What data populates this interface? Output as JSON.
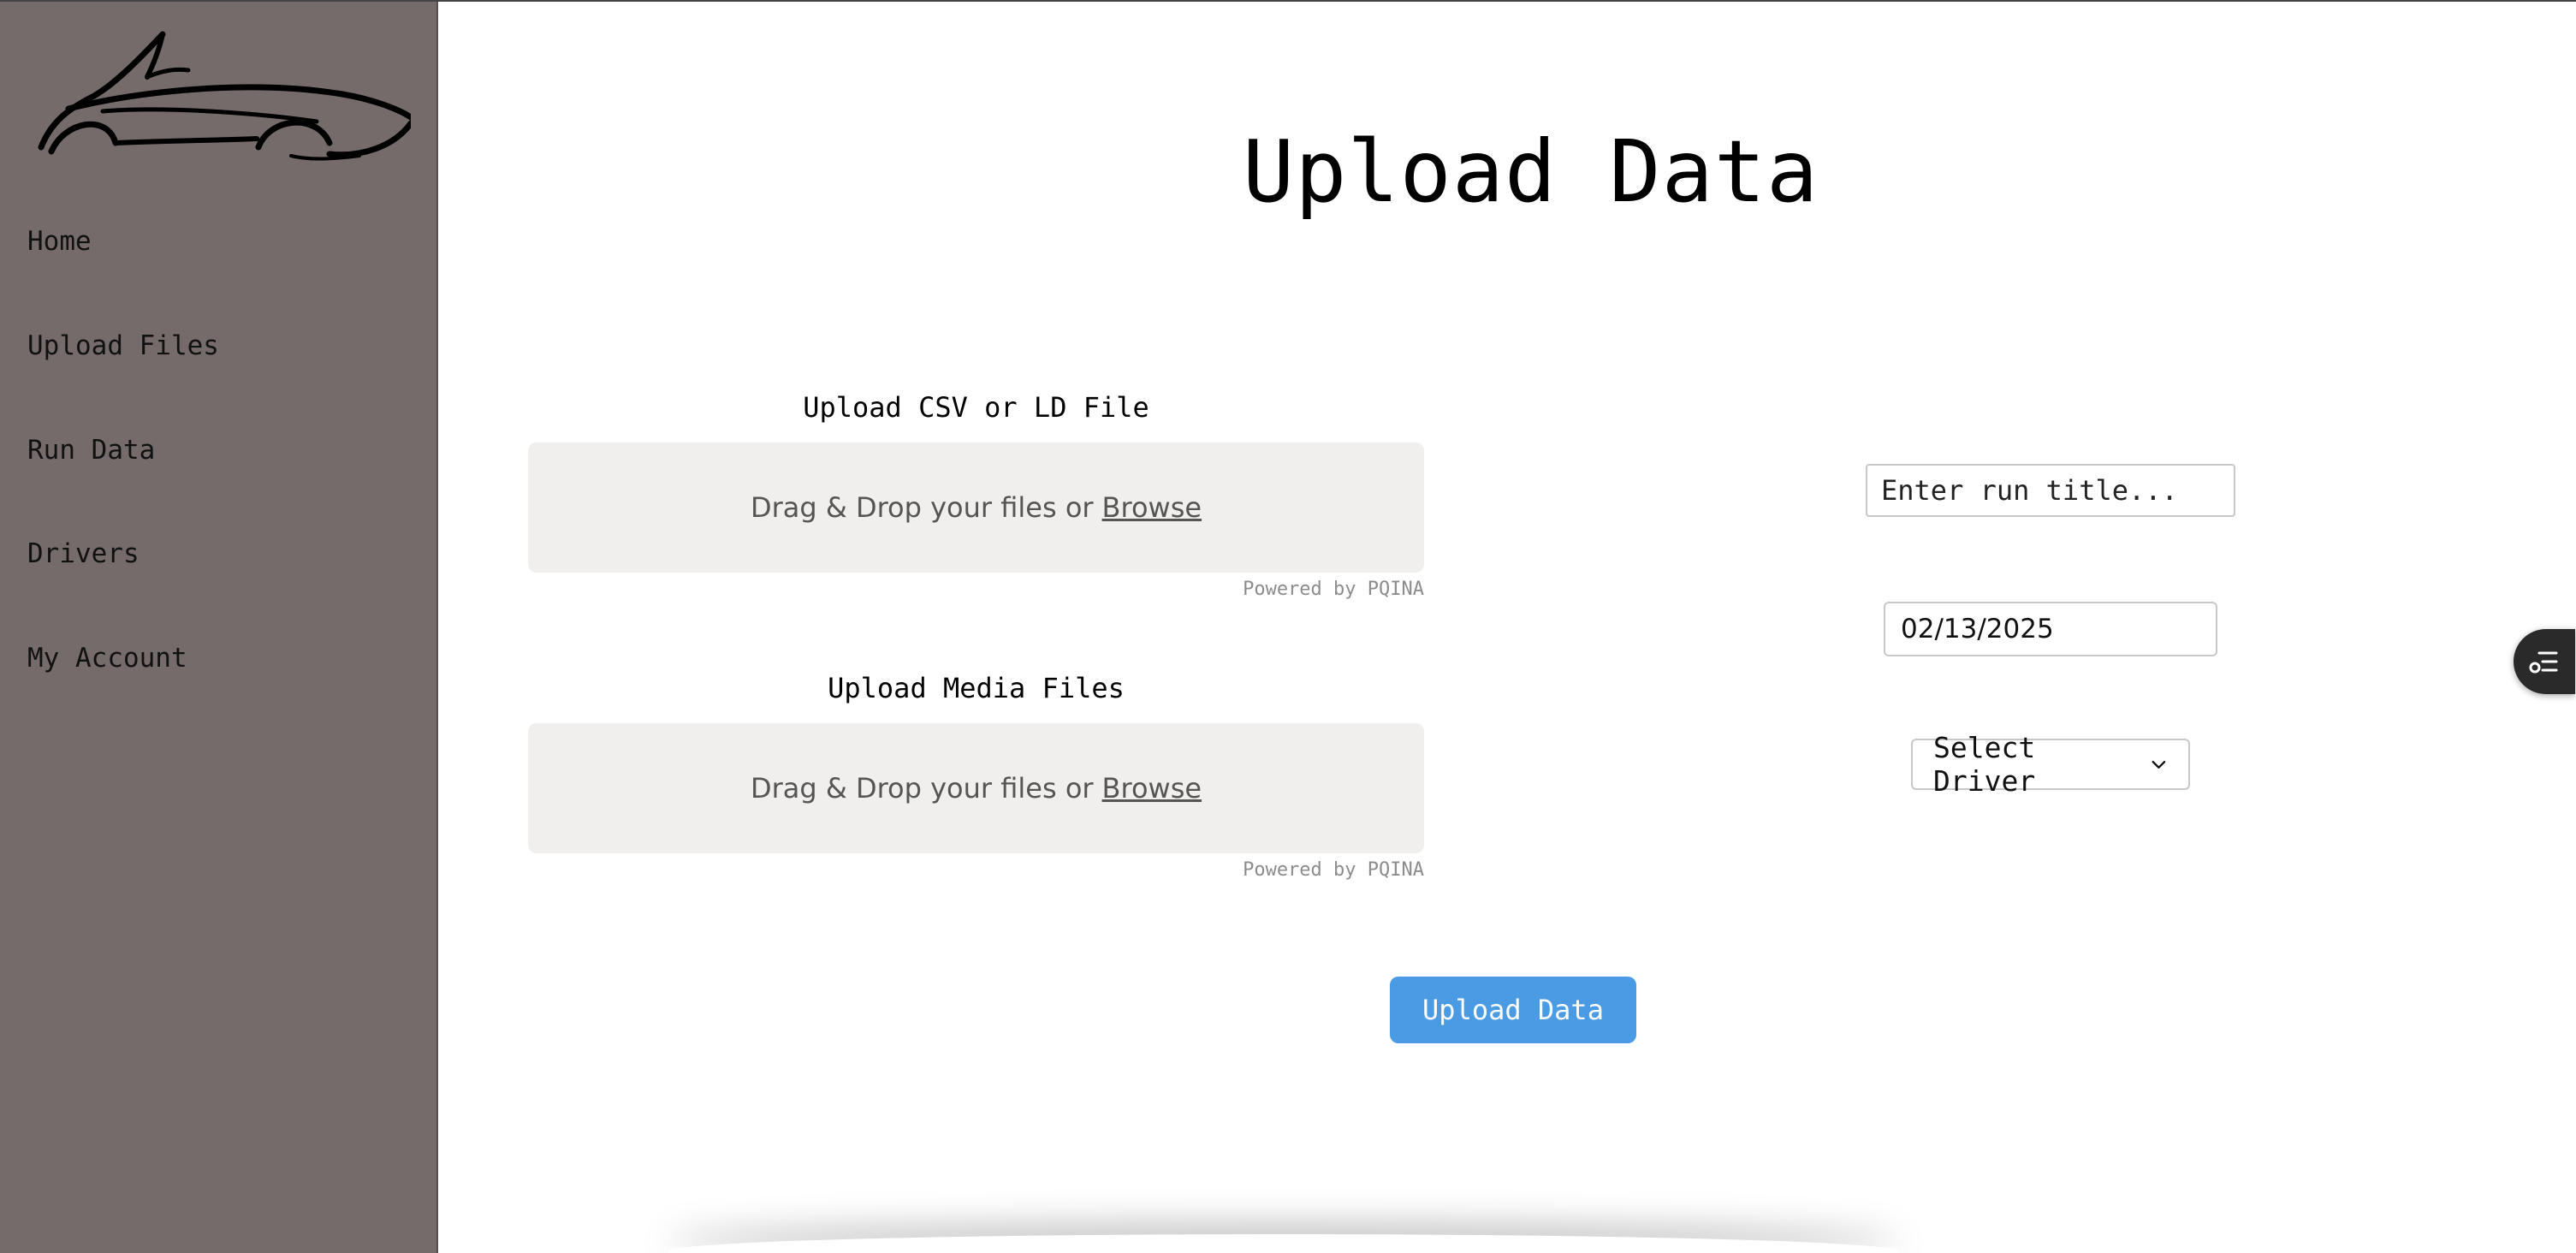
{
  "sidebar": {
    "logo_name": "car-outline-logo",
    "items": [
      {
        "label": "Home"
      },
      {
        "label": "Upload Files"
      },
      {
        "label": "Run Data"
      },
      {
        "label": "Drivers"
      },
      {
        "label": "My Account"
      }
    ]
  },
  "main": {
    "title": "Upload Data",
    "csv_upload": {
      "label": "Upload CSV or LD File",
      "drop_text": "Drag & Drop your files or",
      "browse_label": "Browse",
      "powered_by": "Powered by PQINA"
    },
    "media_upload": {
      "label": "Upload Media Files",
      "drop_text": "Drag & Drop your files or",
      "browse_label": "Browse",
      "powered_by": "Powered by PQINA"
    },
    "form": {
      "run_title_placeholder": "Enter run title...",
      "run_title_value": "",
      "date_value": "02/13/2025",
      "driver_select_value": "Select Driver"
    },
    "submit_label": "Upload Data"
  },
  "colors": {
    "sidebar_bg": "#766b6b",
    "dropzone_bg": "#f0efee",
    "button_bg": "#4a9be3",
    "floating_button_bg": "#2a2a2a"
  },
  "icons": {
    "floating": "filter-list-icon",
    "select_arrow": "chevron-down-icon"
  }
}
